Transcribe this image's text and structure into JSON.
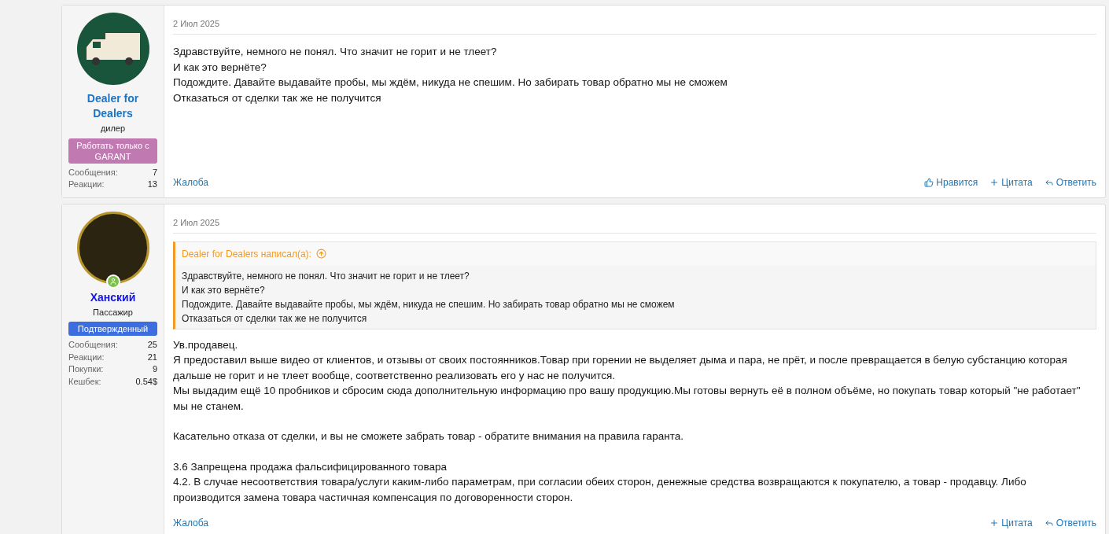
{
  "posts": [
    {
      "user": {
        "name": "Dealer for Dealers",
        "color": "#1c74c4",
        "avatar": {
          "kind": "truck"
        },
        "online": false,
        "title": "дилер",
        "banner": {
          "text": "Работать только с GARANT",
          "color": "#c07ab1"
        },
        "stats": [
          {
            "label": "Сообщения:",
            "value": "7"
          },
          {
            "label": "Реакции:",
            "value": "13"
          }
        ]
      },
      "date": "2 Июл 2025",
      "body": [
        [
          "Здравствуйте, немного не понял. Что значит не горит и не тлеет?",
          "И как это вернёте?",
          "Подождите. Давайте выдавайте пробы, мы ждём, никуда не спешим. Но забирать товар обратно мы не сможем",
          "Отказаться от сделки так же не получится"
        ]
      ],
      "report": "Жалоба",
      "actions": [
        {
          "kind": "like",
          "label": "Нравится"
        },
        {
          "kind": "quote",
          "label": "Цитата"
        },
        {
          "kind": "reply",
          "label": "Ответить"
        }
      ]
    },
    {
      "user": {
        "name": "Ханский",
        "color": "#1414e6",
        "avatar": {
          "kind": "photo"
        },
        "online": true,
        "title": "Пассажир",
        "banner": {
          "text": "Подтвержденный",
          "color": "#3d6ee0"
        },
        "stats": [
          {
            "label": "Сообщения:",
            "value": "25"
          },
          {
            "label": "Реакции:",
            "value": "21"
          },
          {
            "label": "Покупки:",
            "value": "9"
          },
          {
            "label": "Кешбек:",
            "value": "0.54$"
          }
        ]
      },
      "date": "2 Июл 2025",
      "quote": {
        "author": "Dealer for Dealers написал(а):",
        "lines": [
          "Здравствуйте, немного не понял. Что значит не горит и не тлеет?",
          "И как это вернёте?",
          "Подождите. Давайте выдавайте пробы, мы ждём, никуда не спешим. Но забирать товар обратно мы не сможем",
          "Отказаться от сделки так же не получится"
        ]
      },
      "body": [
        [
          "Ув.продавец.",
          "Я предоставил выше видео от клиентов, и отзывы от своих постоянников.Товар при горении не выделяет дыма и пара, не прёт, и после превращается в белую субстанцию которая дальше не горит и не тлеет вообще, соответственно реализовать его у нас не получится.",
          "Мы выдадим ещё 10 пробников и сбросим сюда дополнительную информацию про вашу продукцию.Мы готовы вернуть её в полном объёме, но покупать товар который \"не работает\" мы не станем."
        ],
        [
          "Касательно отказа от сделки, и вы не сможете забрать товар - обратите внимания на правила гаранта."
        ],
        [
          "3.6 Запрещена продажа фальсифицированного товара",
          "4.2. В случае несоответствия товара/услуги каким-либо параметрам, при согласии обеих сторон, денежные средства возвращаются к покупателю, а товар - продавцу. Либо производится замена товара частичная компенсация по договоренности сторон."
        ]
      ],
      "report": "Жалоба",
      "actions": [
        {
          "kind": "quote",
          "label": "Цитата"
        },
        {
          "kind": "reply",
          "label": "Ответить"
        }
      ]
    }
  ]
}
